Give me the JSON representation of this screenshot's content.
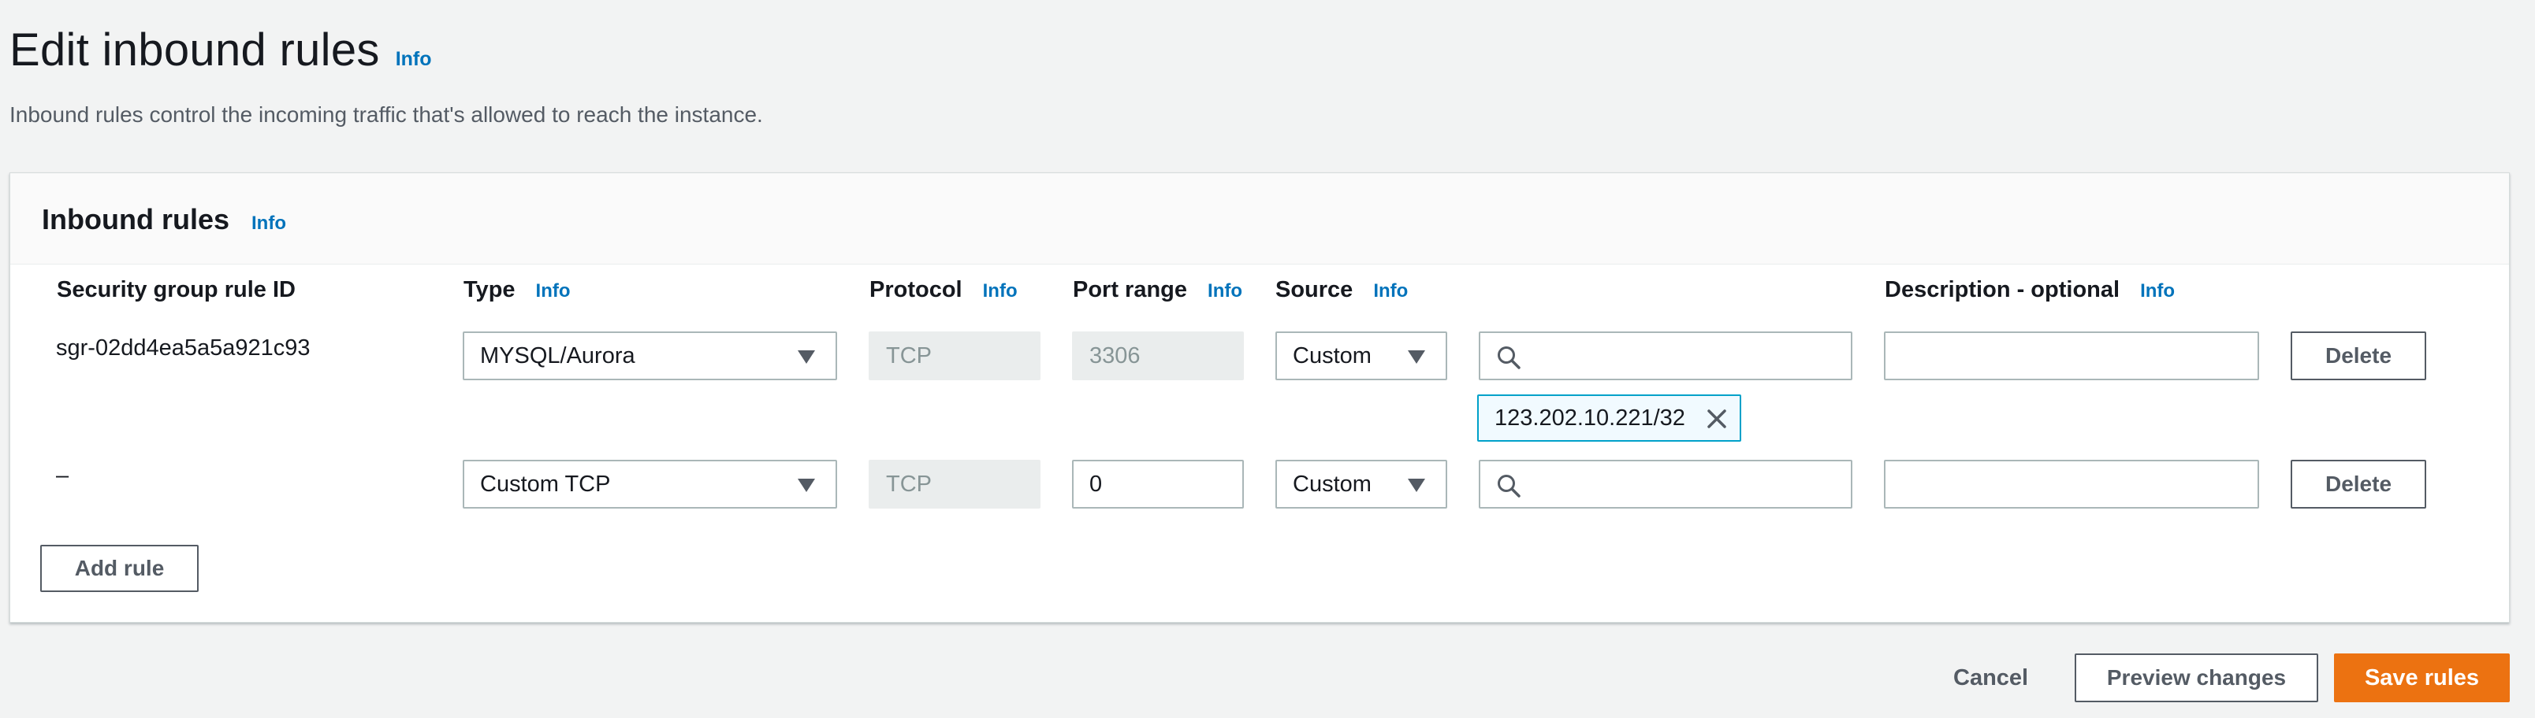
{
  "page": {
    "title": "Edit inbound rules",
    "title_info": "Info",
    "subtitle": "Inbound rules control the incoming traffic that's allowed to reach the instance."
  },
  "panel": {
    "title": "Inbound rules",
    "info": "Info"
  },
  "columns": {
    "rule_id": "Security group rule ID",
    "type": "Type",
    "type_info": "Info",
    "protocol": "Protocol",
    "protocol_info": "Info",
    "port_range": "Port range",
    "port_range_info": "Info",
    "source": "Source",
    "source_info": "Info",
    "description": "Description - optional",
    "description_info": "Info"
  },
  "rules": [
    {
      "id": "sgr-02dd4ea5a5a921c93",
      "type": "MYSQL/Aurora",
      "protocol": "TCP",
      "port_range": "3306",
      "source": "Custom",
      "source_search": "",
      "source_token": "123.202.10.221/32",
      "description": "",
      "delete_label": "Delete"
    },
    {
      "id": "–",
      "type": "Custom TCP",
      "protocol": "TCP",
      "port_range": "0",
      "source": "Custom",
      "source_search": "",
      "description": "",
      "delete_label": "Delete"
    }
  ],
  "add_rule_label": "Add rule",
  "footer": {
    "cancel": "Cancel",
    "preview": "Preview changes",
    "save": "Save rules"
  },
  "icons": {
    "search": "search-icon",
    "caret": "caret-down-icon",
    "close": "close-icon"
  },
  "colors": {
    "accent_link": "#0073bb",
    "primary_button": "#ec7211",
    "token_border": "#00a1c9",
    "token_bg": "#f1faff"
  }
}
